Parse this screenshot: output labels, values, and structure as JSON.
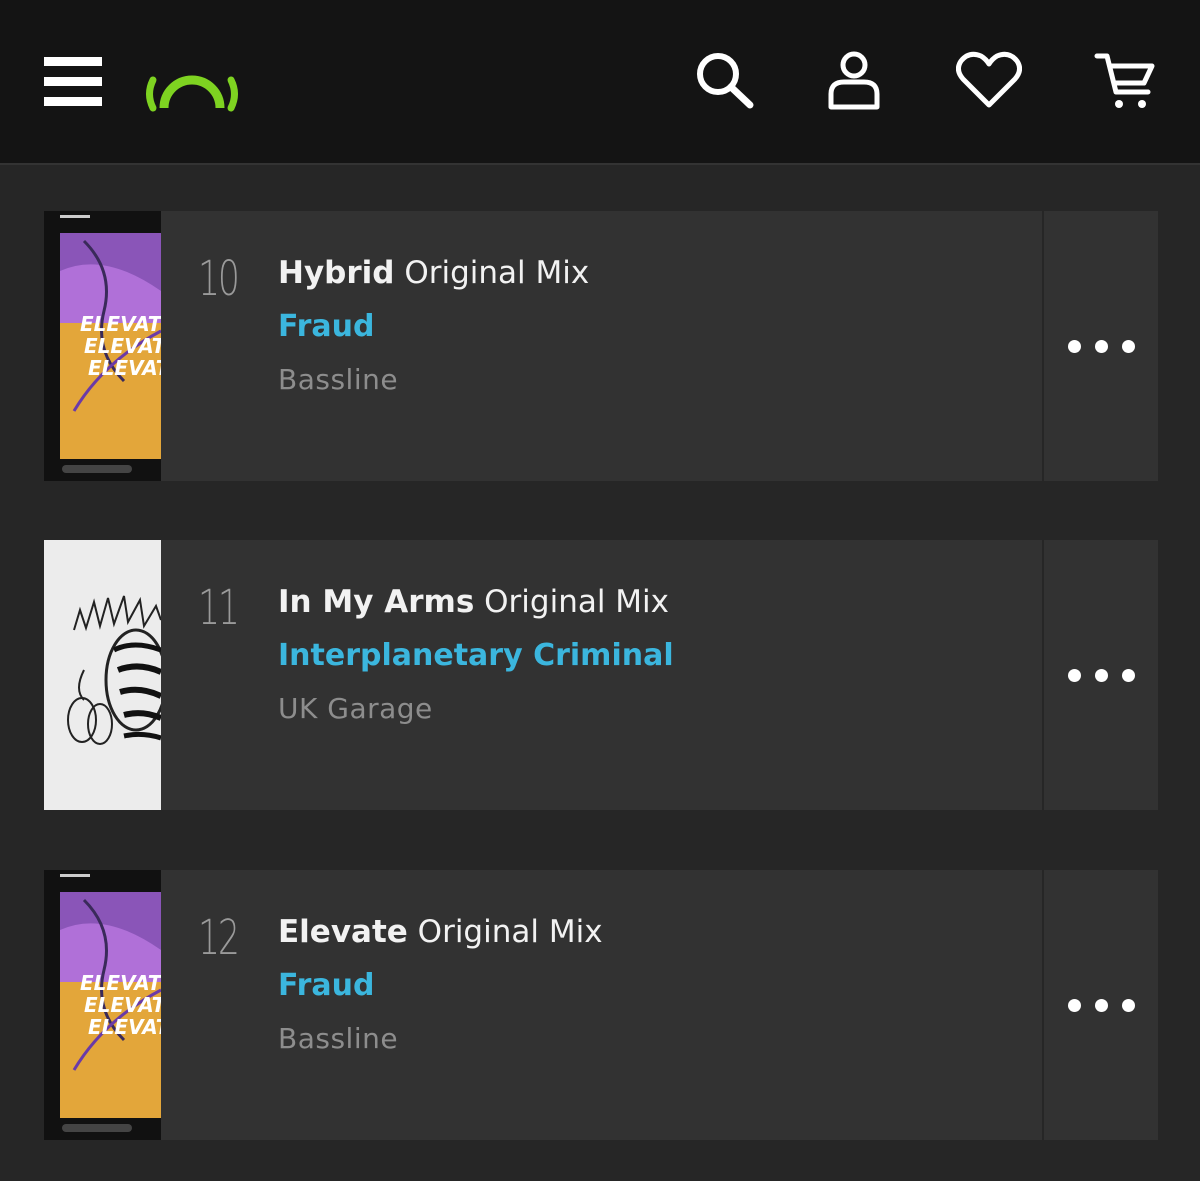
{
  "header": {
    "icons": [
      "menu-icon",
      "beatport-logo",
      "search-icon",
      "user-icon",
      "heart-icon",
      "cart-icon"
    ],
    "brand_color": "#7ed321"
  },
  "tracks": [
    {
      "number": "10",
      "title": "Hybrid",
      "mix": "Original Mix",
      "artist": "Fraud",
      "genre": "Bassline",
      "artwork_text": "ELEVATE"
    },
    {
      "number": "11",
      "title": "In My Arms",
      "mix": "Original Mix",
      "artist": "Interplanetary Criminal",
      "genre": "UK Garage"
    },
    {
      "number": "12",
      "title": "Elevate",
      "mix": "Original Mix",
      "artist": "Fraud",
      "genre": "Bassline",
      "artwork_text": "ELEVATE"
    }
  ],
  "colors": {
    "artist": "#3bb6de",
    "title": "#f2f2f2",
    "genre": "#8d8d8d"
  }
}
